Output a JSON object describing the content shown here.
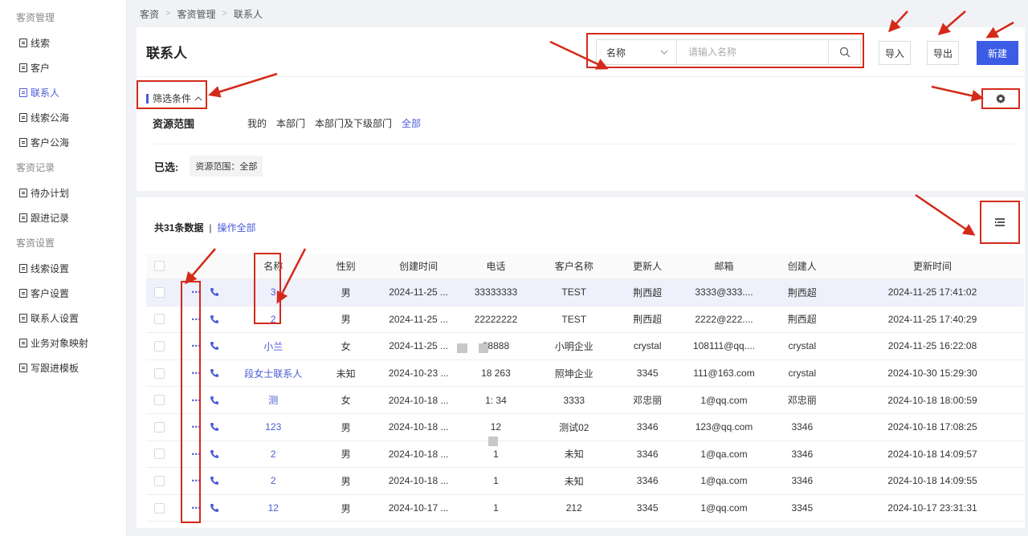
{
  "sidebar": {
    "groups": [
      {
        "label": "客资管理",
        "items": [
          {
            "label": "线索"
          },
          {
            "label": "客户"
          },
          {
            "label": "联系人",
            "active": true
          },
          {
            "label": "线索公海"
          },
          {
            "label": "客户公海"
          }
        ]
      },
      {
        "label": "客资记录",
        "items": [
          {
            "label": "待办计划"
          },
          {
            "label": "跟进记录"
          }
        ]
      },
      {
        "label": "客资设置",
        "items": [
          {
            "label": "线索设置"
          },
          {
            "label": "客户设置"
          },
          {
            "label": "联系人设置"
          },
          {
            "label": "业务对象映射"
          },
          {
            "label": "写跟进模板"
          }
        ]
      }
    ]
  },
  "breadcrumb": [
    "客资",
    "客资管理",
    "联系人"
  ],
  "header": {
    "title": "联系人",
    "search_field": "名称",
    "search_placeholder": "请输入名称",
    "import_label": "导入",
    "export_label": "导出",
    "new_label": "新建"
  },
  "filter": {
    "toggle_label": "筛选条件",
    "scope_label": "资源范围",
    "scope_options": [
      "我的",
      "本部门",
      "本部门及下级部门",
      "全部"
    ],
    "scope_active": "全部",
    "chosen_label": "已选:",
    "chosen_tag": "资源范围：全部"
  },
  "list": {
    "count_text": "共31条数据",
    "separator": "|",
    "operate_all": "操作全部",
    "columns": [
      "名称",
      "性别",
      "创建时间",
      "电话",
      "客户名称",
      "更新人",
      "邮箱",
      "创建人",
      "更新时间"
    ],
    "rows": [
      {
        "name": "3",
        "sex": "男",
        "ctime": "2024-11-25 ...",
        "phone": "33333333",
        "customer": "TEST",
        "updater": "荆西超",
        "email": "3333@333....",
        "creator": "荆西超",
        "utime": "2024-11-25 17:41:02"
      },
      {
        "name": "2",
        "sex": "男",
        "ctime": "2024-11-25 ...",
        "phone": "22222222",
        "customer": "TEST",
        "updater": "荆西超",
        "email": "2222@222....",
        "creator": "荆西超",
        "utime": "2024-11-25 17:40:29"
      },
      {
        "name": "小兰",
        "sex": "女",
        "ctime": "2024-11-25 ...",
        "phone": "88888",
        "customer": "小明企业",
        "updater": "crystal",
        "email": "108111@qq....",
        "creator": "crystal",
        "utime": "2024-11-25 16:22:08"
      },
      {
        "name": "段女士联系人",
        "sex": "未知",
        "ctime": "2024-10-23 ...",
        "phone": "18    263",
        "customer": "照坤企业",
        "updater": "3345",
        "email": "111@163.com",
        "creator": "crystal",
        "utime": "2024-10-30 15:29:30"
      },
      {
        "name": "测",
        "sex": "女",
        "ctime": "2024-10-18 ...",
        "phone": "1:    34",
        "customer": "3333",
        "updater": "邓忠丽",
        "email": "1@qq.com",
        "creator": "邓忠丽",
        "utime": "2024-10-18 18:00:59"
      },
      {
        "name": "123",
        "sex": "男",
        "ctime": "2024-10-18 ...",
        "phone": "12",
        "customer": "测试02",
        "updater": "3346",
        "email": "123@qq.com",
        "creator": "3346",
        "utime": "2024-10-18 17:08:25"
      },
      {
        "name": "2",
        "sex": "男",
        "ctime": "2024-10-18 ...",
        "phone": "1",
        "customer": "未知",
        "updater": "3346",
        "email": "1@qa.com",
        "creator": "3346",
        "utime": "2024-10-18 14:09:57"
      },
      {
        "name": "2",
        "sex": "男",
        "ctime": "2024-10-18 ...",
        "phone": "1",
        "customer": "未知",
        "updater": "3346",
        "email": "1@qa.com",
        "creator": "3346",
        "utime": "2024-10-18 14:09:55"
      },
      {
        "name": "12",
        "sex": "男",
        "ctime": "2024-10-17 ...",
        "phone": "1",
        "customer": "212",
        "updater": "3345",
        "email": "1@qq.com",
        "creator": "3345",
        "utime": "2024-10-17 23:31:31"
      }
    ]
  },
  "colors": {
    "accent": "#3c5ce6",
    "link": "#4a5bd6",
    "annotation": "#d42a1a"
  },
  "icons": [
    "document-icon",
    "chevron-down-icon",
    "search-icon",
    "chevron-up-icon",
    "gear-icon",
    "column-settings-icon",
    "more-dots-icon",
    "phone-icon"
  ]
}
